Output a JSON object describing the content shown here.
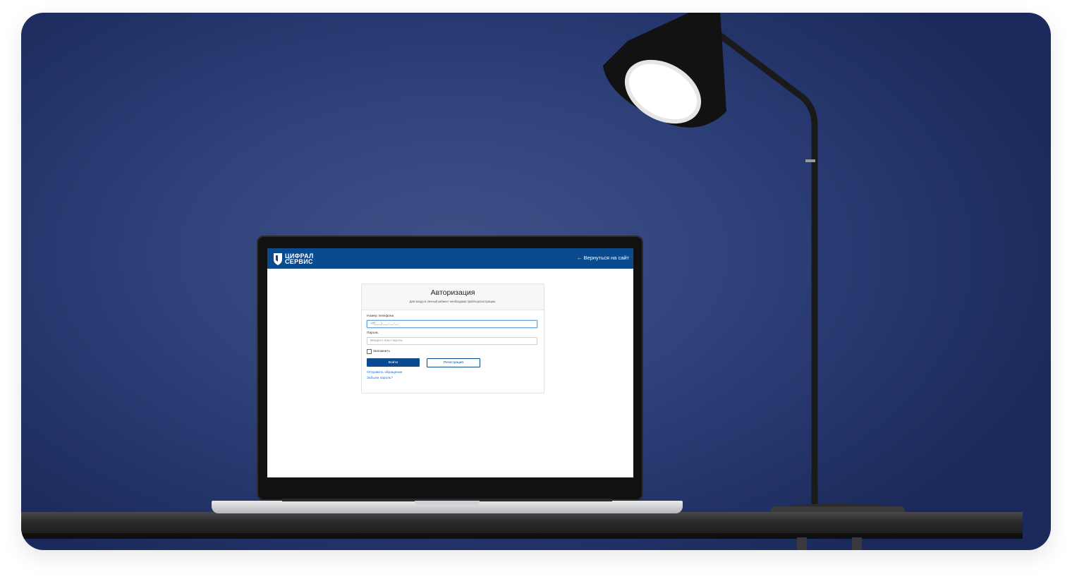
{
  "colors": {
    "background_blue": "#2f427a",
    "brand_blue": "#0a4a8f",
    "link_blue": "#1a6cc4"
  },
  "app": {
    "logo": {
      "line1": "ЦИФРАЛ",
      "line2": "СЕРВИС",
      "icon": "shield-icon"
    },
    "back_link": "← Вернуться на сайт",
    "auth": {
      "title": "Авторизация",
      "subtitle": "Для входа в личный кабинет необходимо пройти регистрацию.",
      "phone_label": "Номер телефона",
      "phone_value": "+7(___) ___-__-__",
      "password_label": "Пароль",
      "password_placeholder": "Введите ваш пароль",
      "remember_label": "Запомнить",
      "login_button": "Войти",
      "register_button": "Регистрация",
      "send_request_link": "Отправить обращение",
      "forgot_password_link": "Забыли пароль?"
    }
  }
}
